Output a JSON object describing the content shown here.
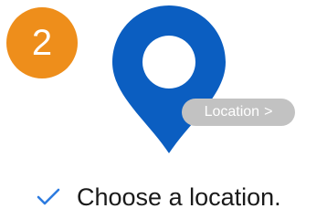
{
  "step": {
    "number": "2",
    "color": "#ee8e1b"
  },
  "pin": {
    "icon": "map-pin-icon",
    "color": "#0b5ec1"
  },
  "location_chip": {
    "label": "Location",
    "chevron": ">",
    "color": "#c2c2c2"
  },
  "instruction": {
    "icon": "checkmark-icon",
    "icon_color": "#2d7be0",
    "text": "Choose a location."
  }
}
